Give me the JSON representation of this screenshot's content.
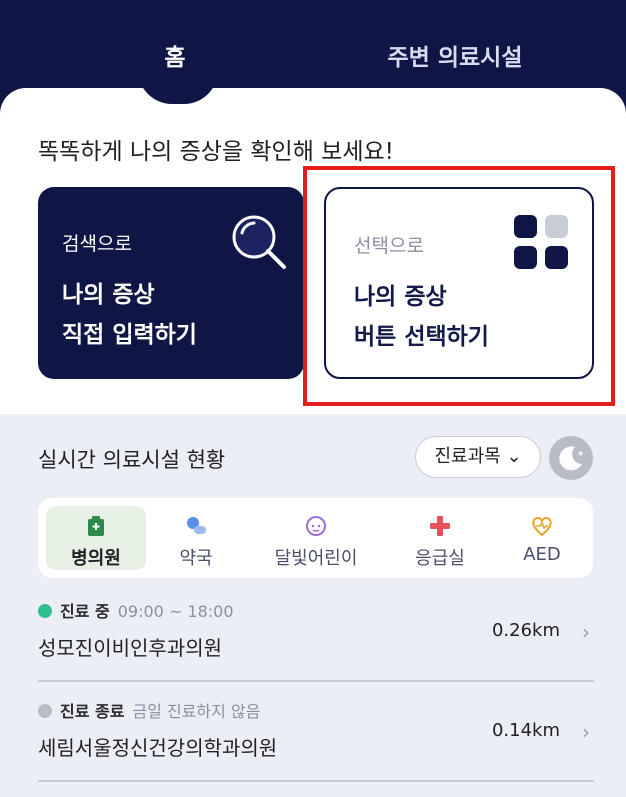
{
  "tabs": {
    "home": "홈",
    "nearby": "주변 의료시설"
  },
  "headline": "똑똑하게 나의 증상을 확인해 보세요!",
  "search_card": {
    "sub": "검색으로",
    "main_line1": "나의 증상",
    "main_line2": "직접 입력하기",
    "icon": "search-icon"
  },
  "select_card": {
    "sub": "선택으로",
    "main_line1": "나의 증상",
    "main_line2": "버튼 선택하기",
    "icon": "grid-icon"
  },
  "realtime": {
    "title": "실시간 의료시설 현황",
    "department": "진료과목",
    "chevron": "⌄"
  },
  "categories": [
    {
      "label": "병의원",
      "icon": "hospital-icon",
      "active": true
    },
    {
      "label": "약국",
      "icon": "pharmacy-icon",
      "active": false
    },
    {
      "label": "달빛어린이",
      "icon": "child-icon",
      "active": false
    },
    {
      "label": "응급실",
      "icon": "emergency-cross-icon",
      "active": false
    },
    {
      "label": "AED",
      "icon": "aed-heart-icon",
      "active": false
    }
  ],
  "facilities": [
    {
      "status": "진료 중",
      "hours": "09:00 ~ 18:00",
      "name": "성모진이비인후과의원",
      "distance": "0.26km",
      "status_color": "#2fbf8f"
    },
    {
      "status": "진료 종료",
      "hours": "금일 진료하지 않음",
      "name": "세림서울정신건강의학과의원",
      "distance": "0.14km",
      "status_color": "#b8bcc6"
    }
  ],
  "colors": {
    "navy": "#0f1645",
    "highlight": "#e41d1d",
    "bg_lower": "#eceef6"
  }
}
